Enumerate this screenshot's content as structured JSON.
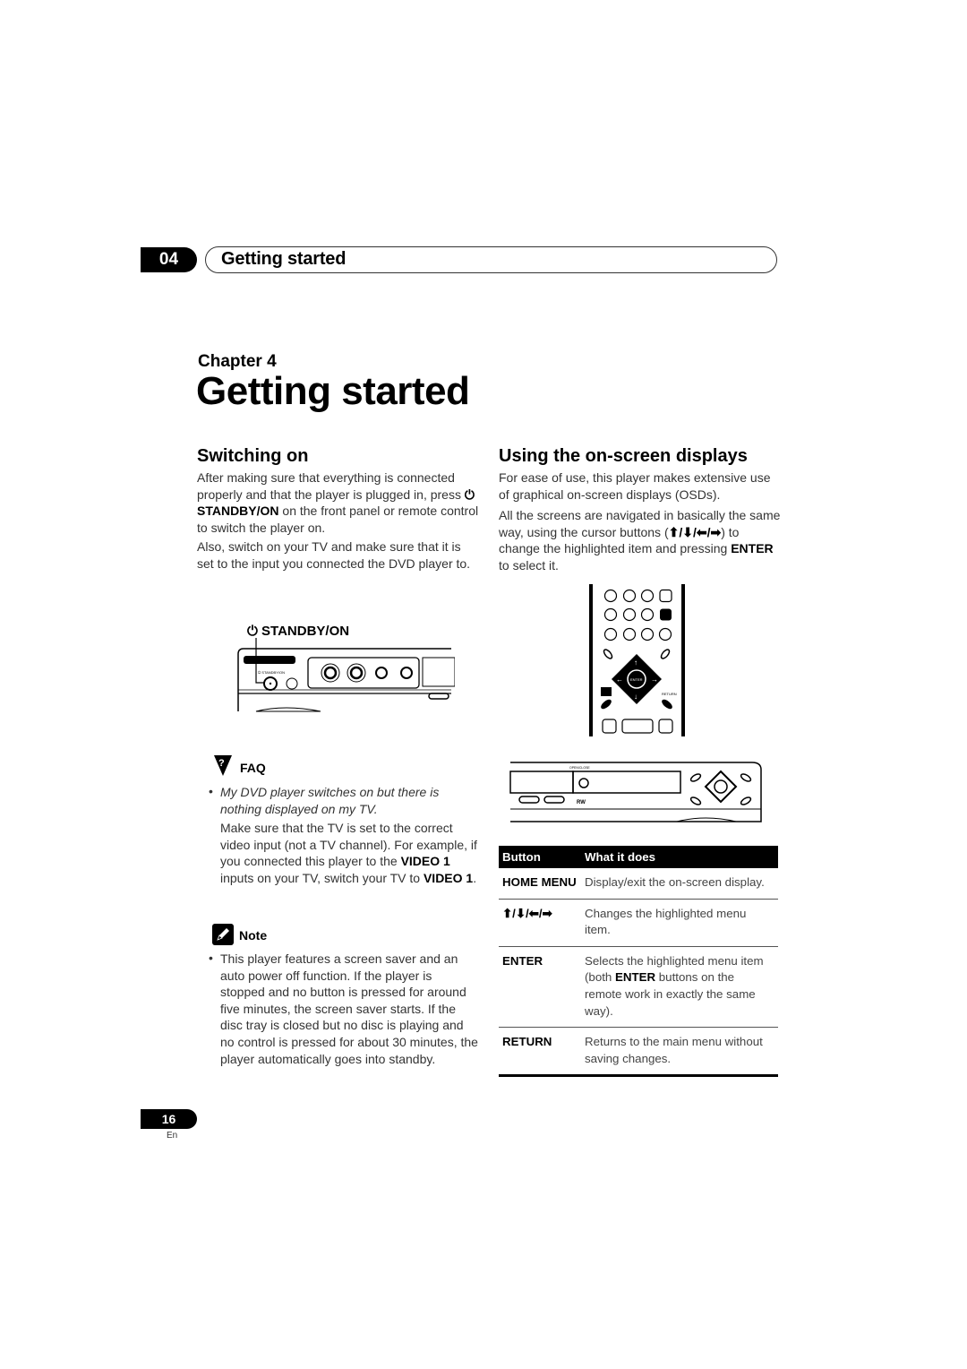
{
  "header": {
    "chapter_number": "04",
    "chapter_name": "Getting started"
  },
  "chapter": {
    "label": "Chapter 4",
    "title": "Getting started"
  },
  "switching_on": {
    "heading": "Switching on",
    "p1_before": "After making sure that everything is connected properly and that the player is plugged in, press ",
    "p1_bold": "STANDBY/ON",
    "p1_after": " on the front panel or remote control to switch the player on.",
    "p2": "Also, switch on your TV and make sure that it is set to the input you connected the DVD player to.",
    "illustration_label": "STANDBY/ON"
  },
  "faq": {
    "title": "FAQ",
    "question": "My DVD player switches on but there is nothing displayed on my TV.",
    "answer_before": "Make sure that the TV is set to the correct video input (not a TV channel). For example, if you connected this player to the ",
    "answer_bold1": "VIDEO 1",
    "answer_mid": " inputs on your TV, switch your TV to ",
    "answer_bold2": "VIDEO 1",
    "answer_after": "."
  },
  "note": {
    "title": "Note",
    "text": "This player features a screen saver and an auto power off function. If the player is stopped and no button is pressed for around five minutes, the screen saver starts. If the disc tray is closed but no disc is playing and no control is pressed for about 30 minutes, the player automatically goes into standby."
  },
  "osd": {
    "heading": "Using the on-screen displays",
    "p1": "For ease of use, this player makes extensive use of graphical on-screen displays (OSDs).",
    "p2_before": "All the screens are navigated in basically the same way, using the cursor buttons (",
    "p2_arrows": "⬆/⬇/⬅/➡",
    "p2_mid": ") to change the highlighted item and pressing ",
    "p2_bold": "ENTER",
    "p2_after": " to select it."
  },
  "table": {
    "headers": [
      "Button",
      "What it does"
    ],
    "rows": [
      {
        "button": "HOME MENU",
        "desc": "Display/exit the on-screen display."
      },
      {
        "button": "⬆/⬇/⬅/➡",
        "desc": "Changes the highlighted menu item."
      },
      {
        "button": "ENTER",
        "desc_before": "Selects the highlighted menu item (both ",
        "desc_bold": "ENTER",
        "desc_after": " buttons on the remote work in exactly the same way)."
      },
      {
        "button": "RETURN",
        "desc": "Returns to the main menu without saving changes."
      }
    ]
  },
  "footer": {
    "page_number": "16",
    "language": "En"
  }
}
